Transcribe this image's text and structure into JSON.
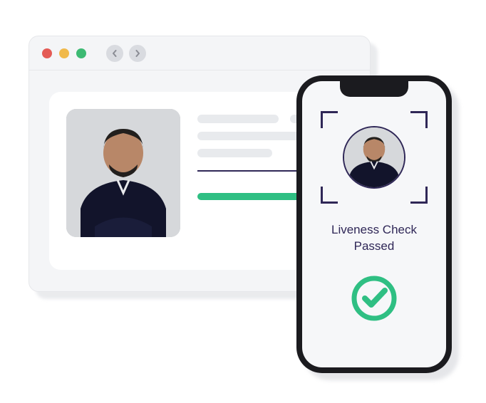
{
  "phone": {
    "status_text": "Liveness Check\nPassed"
  },
  "icons": {
    "window_close": "close",
    "window_minimize": "minimize",
    "window_maximize": "maximize",
    "nav_back": "back",
    "nav_forward": "forward",
    "checkmark": "success-check"
  },
  "colors": {
    "accent_dark": "#2f2757",
    "success": "#2fbf83",
    "progress": "#2fbf83"
  }
}
